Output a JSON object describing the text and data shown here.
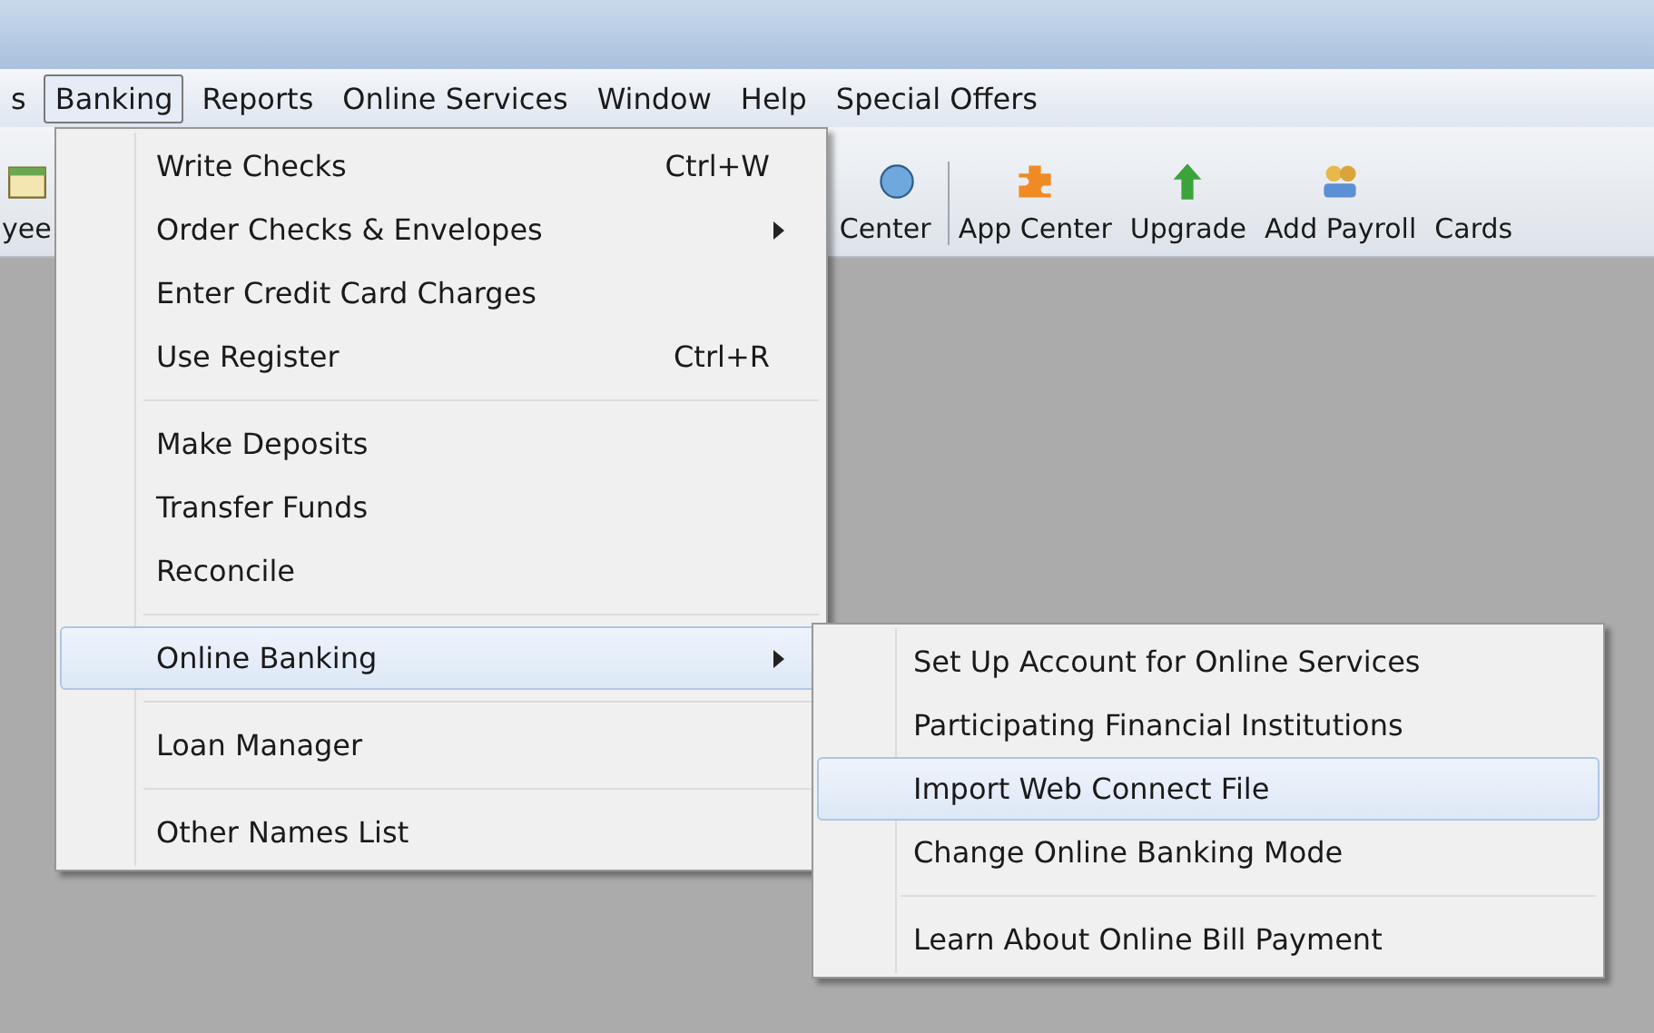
{
  "menu_bar": [
    {
      "label": "s",
      "selected": false
    },
    {
      "label": "Banking",
      "selected": true
    },
    {
      "label": "Reports",
      "selected": false
    },
    {
      "label": "Online Services",
      "selected": false
    },
    {
      "label": "Window",
      "selected": false
    },
    {
      "label": "Help",
      "selected": false
    },
    {
      "label": "Special Offers",
      "selected": false
    }
  ],
  "toolbar": [
    {
      "label": "yee"
    },
    {
      "label": "Center"
    },
    {
      "label": "App Center"
    },
    {
      "label": "Upgrade"
    },
    {
      "label": "Add Payroll"
    },
    {
      "label": "Cards"
    }
  ],
  "banking_menu": {
    "groups": [
      [
        {
          "label": "Write Checks",
          "shortcut": "Ctrl+W",
          "submenu": false,
          "selected": false
        },
        {
          "label": "Order Checks & Envelopes",
          "submenu": true,
          "selected": false
        },
        {
          "label": "Enter Credit Card Charges",
          "submenu": false,
          "selected": false
        },
        {
          "label": "Use Register",
          "shortcut": "Ctrl+R",
          "submenu": false,
          "selected": false
        }
      ],
      [
        {
          "label": "Make Deposits",
          "submenu": false,
          "selected": false
        },
        {
          "label": "Transfer Funds",
          "submenu": false,
          "selected": false
        },
        {
          "label": "Reconcile",
          "submenu": false,
          "selected": false
        }
      ],
      [
        {
          "label": "Online Banking",
          "submenu": true,
          "selected": true
        }
      ],
      [
        {
          "label": "Loan Manager",
          "submenu": false,
          "selected": false
        }
      ],
      [
        {
          "label": "Other Names List",
          "submenu": false,
          "selected": false
        }
      ]
    ]
  },
  "online_banking_submenu": {
    "groups": [
      [
        {
          "label": "Set Up Account for Online Services",
          "selected": false
        },
        {
          "label": "Participating Financial Institutions",
          "selected": false
        },
        {
          "label": "Import Web Connect File",
          "selected": true
        },
        {
          "label": "Change Online Banking Mode",
          "selected": false
        }
      ],
      [
        {
          "label": "Learn About Online Bill Payment",
          "selected": false
        }
      ]
    ]
  }
}
